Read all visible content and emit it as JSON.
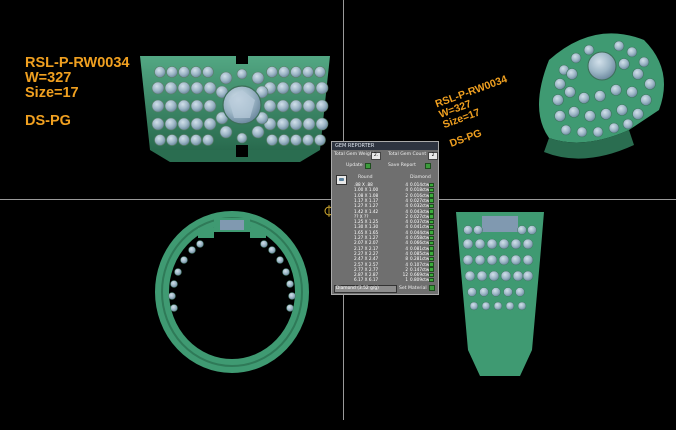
{
  "spec_top_left": {
    "code": "RSL-P-RW0034",
    "weight": "W=327",
    "size": "Size=17",
    "designer": "DS-PG"
  },
  "spec_top_right": {
    "code": "RSL-P-RW0034",
    "weight": "W=327",
    "size": "Size=17",
    "designer": "DS-PG"
  },
  "gem_report": {
    "title": "GEM REPORTER",
    "total_gem_weight_label": "Total Gem Weight",
    "total_gem_weight_value": "2.",
    "total_gem_count_label": "Total Gem Count",
    "total_gem_count_value": "2",
    "update_label": "Update",
    "save_report_label": "Save Report",
    "col_shape": "Round",
    "col_material": "Diamond",
    "rows": [
      {
        "size": ".88 X .88",
        "count": "4",
        "weight": "0.014ctw"
      },
      {
        "size": "1.00 X 1.00",
        "count": "4",
        "weight": "0.018ctw"
      },
      {
        "size": "1.08 X 1.08",
        "count": "2",
        "weight": "0.016ctw"
      },
      {
        "size": "1.17 X 1.17",
        "count": "4",
        "weight": "0.027ctw"
      },
      {
        "size": "1.27 X 1.27",
        "count": "4",
        "weight": "0.032ctw"
      },
      {
        "size": "1.42 X 1.42",
        "count": "4",
        "weight": "0.043ctw"
      },
      {
        "size": "?? X ??",
        "count": "2",
        "weight": "0.027ctw"
      },
      {
        "size": "1.25 X 1.25",
        "count": "4",
        "weight": "0.037ctw"
      },
      {
        "size": "1.30 X 1.30",
        "count": "4",
        "weight": "0.041ctw"
      },
      {
        "size": "1.65 X 1.65",
        "count": "4",
        "weight": "0.044ctw"
      },
      {
        "size": "1.27 X 1.27",
        "count": "4",
        "weight": "0.058ctw"
      },
      {
        "size": "2.07 X 2.07",
        "count": "4",
        "weight": "0.066ctw"
      },
      {
        "size": "2.17 X 2.17",
        "count": "4",
        "weight": "0.081ctw"
      },
      {
        "size": "2.27 X 2.27",
        "count": "4",
        "weight": "0.085ctw"
      },
      {
        "size": "2.47 X 2.47",
        "count": "8",
        "weight": "0.281ctw"
      },
      {
        "size": "2.57 X 2.57",
        "count": "4",
        "weight": "0.107ctw"
      },
      {
        "size": "2.77 X 2.77",
        "count": "2",
        "weight": "0.147ctw"
      },
      {
        "size": "2.87 X 2.87",
        "count": "12",
        "weight": "0.669ctw"
      },
      {
        "size": "6.17 X 6.17",
        "count": "1",
        "weight": "0.809ctw"
      }
    ],
    "material_select": "Diamond  (3.52 g/g)",
    "set_material_label": "Set Material"
  },
  "colors": {
    "spec_text": "#f0a020",
    "ring_metal": "#3f9a72",
    "ring_metal_dark": "#2a6d50",
    "gem": "#9db6c6",
    "viewport_bg": "#000000",
    "divider": "#9a9a9a"
  },
  "icons": {
    "crosshair": "target-icon",
    "axis": "axis-gizmo-icon",
    "ruby": "gem-preview-icon"
  }
}
